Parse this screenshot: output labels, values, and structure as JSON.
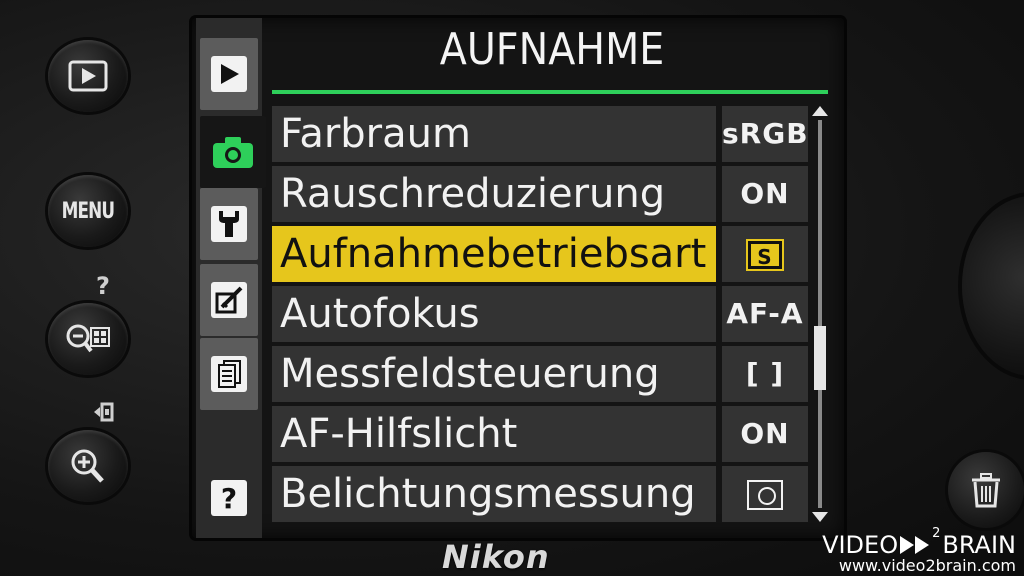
{
  "screen": {
    "title": "AUFNAHME",
    "accent_color": "#2ecf5a",
    "highlight_color": "#e6c61c"
  },
  "tabs": [
    {
      "icon": "playback-icon",
      "label": ""
    },
    {
      "icon": "camera-icon",
      "label": ""
    },
    {
      "icon": "wrench-icon",
      "label": ""
    },
    {
      "icon": "retouch-brush-icon",
      "label": ""
    },
    {
      "icon": "recent-settings-icon",
      "label": ""
    },
    {
      "icon": "help-icon",
      "label": "?"
    }
  ],
  "menu": {
    "items": [
      {
        "label": "Farbraum",
        "value": "sRGB"
      },
      {
        "label": "Rauschreduzierung",
        "value": "ON"
      },
      {
        "label": "Aufnahmebetriebsart",
        "value": "S",
        "selected": true
      },
      {
        "label": "Autofokus",
        "value": "AF-A"
      },
      {
        "label": "Messfeldsteuerung",
        "value": "[ ]"
      },
      {
        "label": "AF-Hilfslicht",
        "value": "ON"
      },
      {
        "label": "Belichtungsmessung",
        "value": ""
      }
    ]
  },
  "camera": {
    "menu_button_label": "MENU",
    "help_mark": "?",
    "brand": "Nikon"
  },
  "watermark": {
    "logo_left": "VIDEO",
    "logo_sup": "2",
    "logo_right": "BRAIN",
    "url": "www.video2brain.com"
  }
}
